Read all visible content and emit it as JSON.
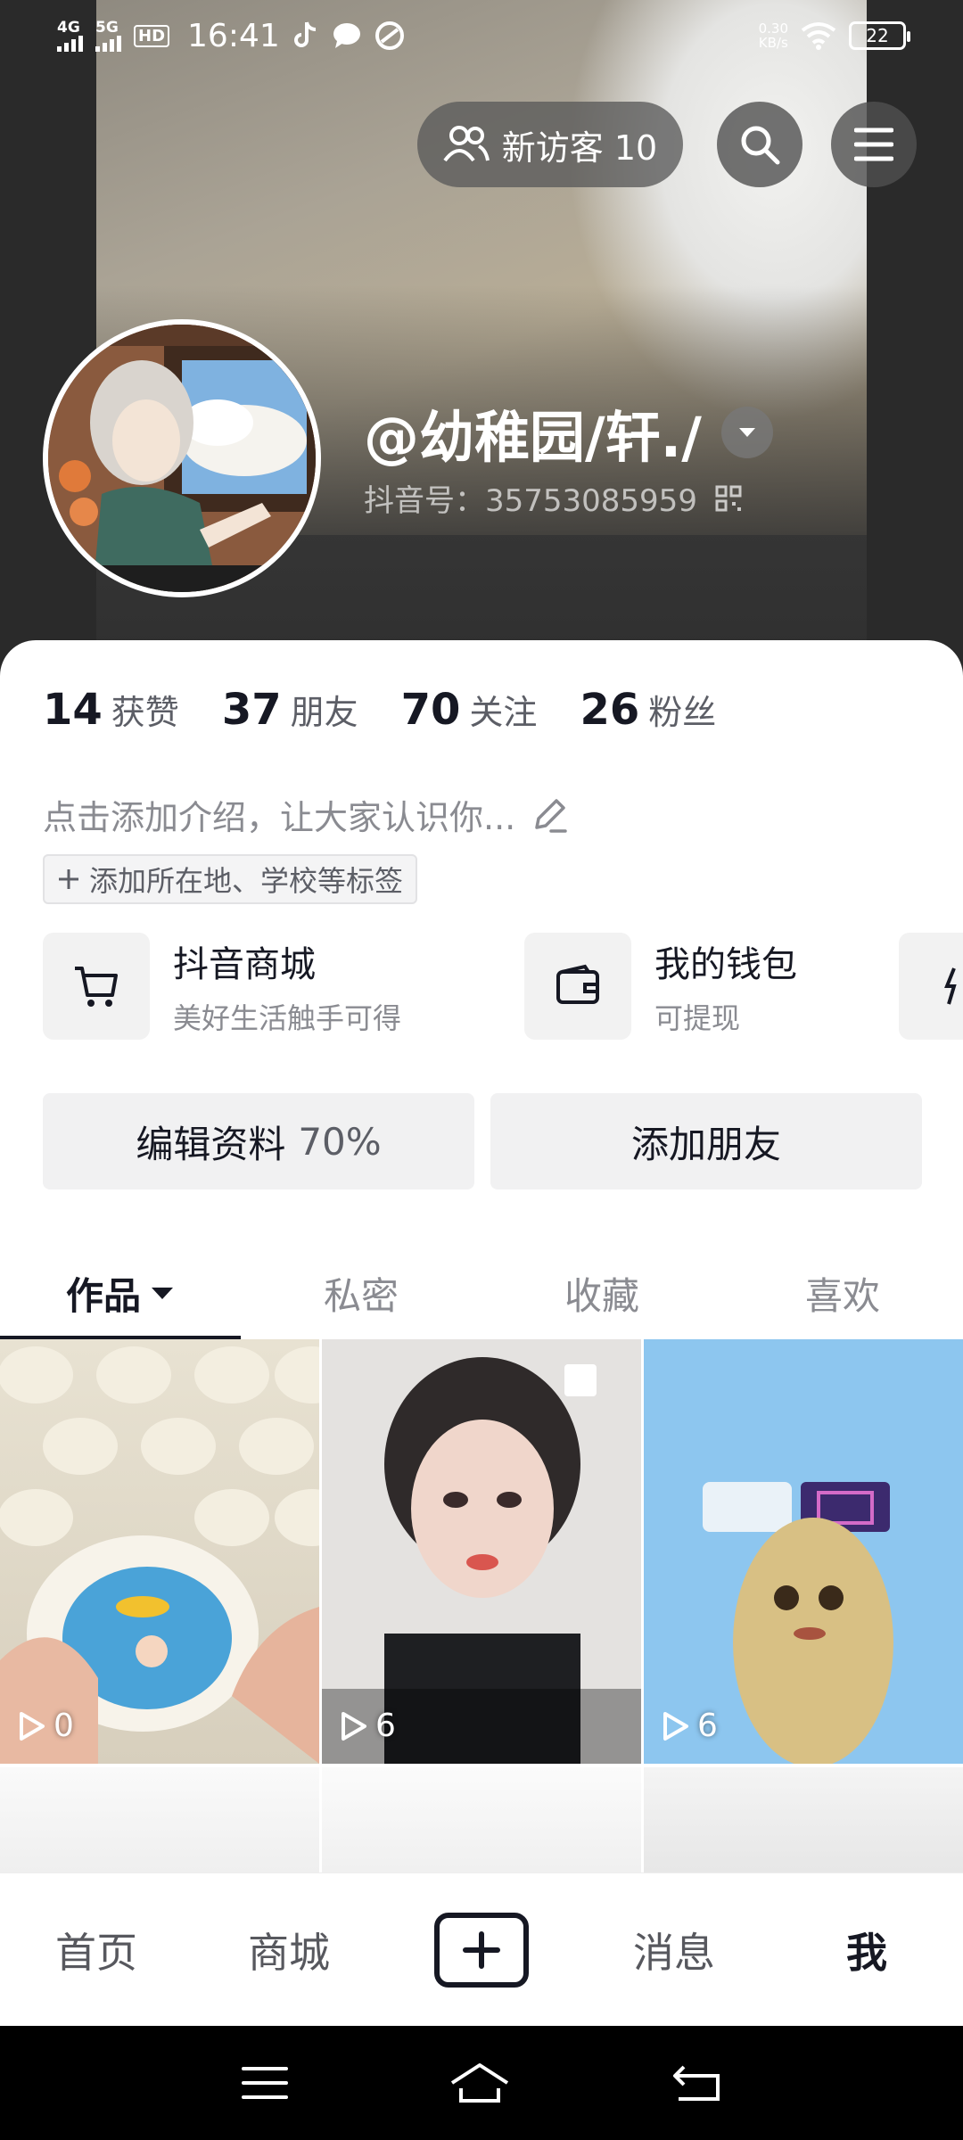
{
  "status_bar": {
    "net1": "4G",
    "net2": "5G",
    "hd": "HD",
    "time": "16:41",
    "speed_value": "0.30",
    "speed_unit": "KB/s",
    "battery": "22"
  },
  "header": {
    "visitors_label": "新访客 10",
    "username": "@幼稚园/轩./",
    "douyin_id": "抖音号：35753085959"
  },
  "stats": [
    {
      "num": "14",
      "label": "获赞"
    },
    {
      "num": "37",
      "label": "朋友"
    },
    {
      "num": "70",
      "label": "关注"
    },
    {
      "num": "26",
      "label": "粉丝"
    }
  ],
  "bio": {
    "placeholder": "点击添加介绍，让大家认识你...",
    "tag_button": "添加所在地、学校等标签"
  },
  "services": [
    {
      "title": "抖音商城",
      "subtitle": "美好生活触手可得",
      "icon": "cart-icon"
    },
    {
      "title": "我的钱包",
      "subtitle": "可提现",
      "icon": "wallet-icon"
    }
  ],
  "actions": {
    "edit_label": "编辑资料",
    "edit_percent": "70%",
    "add_friend": "添加朋友"
  },
  "tabs": [
    "作品",
    "私密",
    "收藏",
    "喜欢"
  ],
  "videos": [
    {
      "plays": "0"
    },
    {
      "plays": "6"
    },
    {
      "plays": "6"
    }
  ],
  "bottom_nav": {
    "home": "首页",
    "mall": "商城",
    "messages": "消息",
    "me": "我"
  },
  "colors": {
    "text_primary": "#161823",
    "text_secondary": "#8a8b91",
    "button_bg": "#f1f1f2"
  }
}
